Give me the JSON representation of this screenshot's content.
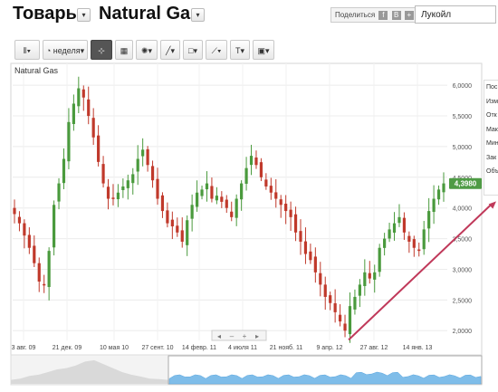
{
  "header": {
    "section_title": "Товары",
    "instrument_title": "Natural Gas",
    "share_label": "Поделиться",
    "share_icons": [
      "f",
      "В",
      "+"
    ],
    "search_value": "Лукойл"
  },
  "toolbar": {
    "period_label": "неделя",
    "buttons": [
      {
        "name": "chart-type-button",
        "glyph": "⫴▾"
      },
      {
        "name": "period-button",
        "glyph": "◔"
      },
      {
        "name": "crosshair-button",
        "glyph": "⊹"
      },
      {
        "name": "calculator-button",
        "glyph": "▦"
      },
      {
        "name": "indicators-button",
        "glyph": "✺▾"
      },
      {
        "name": "line-tool-button",
        "glyph": "╱▾"
      },
      {
        "name": "shape-tool-button",
        "glyph": "□▾"
      },
      {
        "name": "trend-tool-button",
        "glyph": "⟋▾"
      },
      {
        "name": "text-tool-button",
        "glyph": "T▾"
      },
      {
        "name": "image-tool-button",
        "glyph": "▣▾"
      }
    ]
  },
  "side_panel": {
    "rows": [
      "Пос",
      "Изм",
      "Отк",
      "Мак",
      "Мин",
      "Зак",
      "Объ"
    ]
  },
  "nav_controls": [
    "◂",
    "–",
    "+",
    "▸"
  ],
  "chart_data": {
    "type": "candlestick",
    "title": "Natural Gas",
    "y_ticks": [
      "6,0000",
      "5,5000",
      "5,0000",
      "4,5000",
      "4,0000",
      "3,5000",
      "3,0000",
      "2,5000",
      "2,0000"
    ],
    "ylim": [
      1.9,
      6.15
    ],
    "x_tick_labels": [
      "3 авг. 09",
      "21 дек. 09",
      "10 мая 10",
      "27 сент. 10",
      "14 февр. 11",
      "4 июля 11",
      "21 нояб. 11",
      "9 апр. 12",
      "27 авг. 12",
      "14 янв. 13"
    ],
    "last_price_label": "4,3980",
    "last_price": 4.398,
    "closes": [
      3.9,
      3.75,
      3.55,
      3.35,
      3.1,
      2.8,
      2.75,
      3.3,
      4.05,
      4.4,
      4.8,
      5.4,
      5.7,
      5.95,
      5.8,
      5.5,
      5.15,
      4.75,
      4.4,
      4.15,
      4.15,
      4.25,
      4.35,
      4.45,
      4.55,
      4.8,
      4.95,
      4.7,
      4.45,
      4.15,
      3.95,
      3.75,
      3.7,
      3.6,
      3.45,
      3.8,
      4.05,
      4.25,
      4.3,
      4.4,
      4.15,
      4.2,
      4.1,
      4.0,
      3.85,
      4.15,
      4.4,
      4.65,
      4.85,
      4.7,
      4.5,
      4.35,
      4.25,
      4.15,
      4.05,
      3.95,
      3.85,
      3.6,
      3.45,
      3.25,
      3.15,
      2.95,
      2.75,
      2.55,
      2.45,
      2.3,
      2.15,
      2.0,
      2.4,
      2.55,
      2.75,
      2.95,
      2.85,
      2.95,
      3.35,
      3.5,
      3.65,
      3.75,
      3.85,
      3.6,
      3.45,
      3.35,
      3.3,
      3.65,
      3.95,
      4.15,
      4.3,
      4.4
    ],
    "trend_arrow": {
      "from": {
        "index": 67,
        "value": 1.85
      },
      "to": {
        "index": 87,
        "value": 4.02
      },
      "color": "#c0395a"
    },
    "colors": {
      "up": "#4a9a3d",
      "down": "#c0392b",
      "last_price_bg": "#4f9b45",
      "navigator_fill": "#5aa7e0"
    }
  }
}
